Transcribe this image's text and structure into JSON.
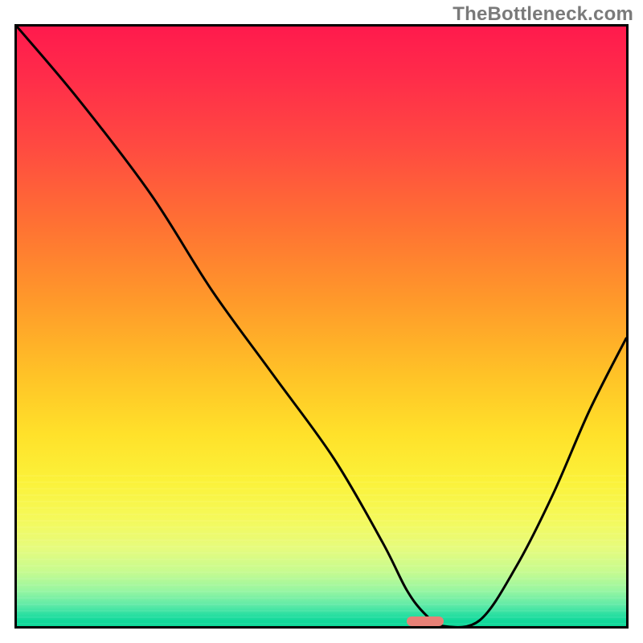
{
  "watermark": "TheBottleneck.com",
  "chart_data": {
    "type": "line",
    "title": "",
    "xlabel": "",
    "ylabel": "",
    "xlim": [
      0,
      100
    ],
    "ylim": [
      0,
      100
    ],
    "grid": false,
    "legend": false,
    "series": [
      {
        "name": "bottleneck-curve",
        "x": [
          0,
          10,
          22,
          32,
          42,
          52,
          60,
          64,
          67,
          70,
          76,
          82,
          88,
          94,
          100
        ],
        "y": [
          100,
          88,
          72,
          56,
          42,
          28,
          14,
          6,
          2,
          0,
          1,
          10,
          22,
          36,
          48
        ]
      }
    ],
    "marker": {
      "name": "optimal-range",
      "x_start": 64,
      "x_end": 70,
      "y": 0.6,
      "color": "#e78177"
    },
    "background": {
      "type": "vertical-gradient",
      "stops": [
        {
          "pct": 0,
          "color": "#ff1a4d"
        },
        {
          "pct": 33,
          "color": "#ff7133"
        },
        {
          "pct": 68,
          "color": "#ffe12a"
        },
        {
          "pct": 87,
          "color": "#e6fb7d"
        },
        {
          "pct": 100,
          "color": "#0bd797"
        }
      ]
    }
  }
}
